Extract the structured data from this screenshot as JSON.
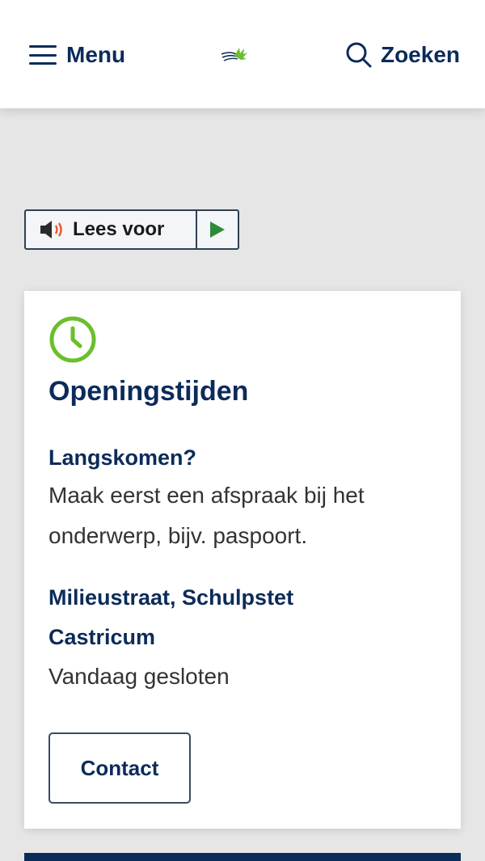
{
  "header": {
    "menu_label": "Menu",
    "search_label": "Zoeken"
  },
  "readspeaker": {
    "label": "Lees voor"
  },
  "card": {
    "title": "Openingstijden",
    "sections": [
      {
        "heading": "Langskomen?",
        "text": "Maak eerst een afspraak bij het onderwerp, bijv. paspoort."
      },
      {
        "heading": "Milieustraat, Schulpstet Castricum",
        "text": "Vandaag gesloten"
      }
    ],
    "contact_label": "Contact"
  },
  "colors": {
    "brand_navy": "#0b2b5a",
    "accent_green": "#6abf2c",
    "speaker_orange": "#e8572a"
  }
}
